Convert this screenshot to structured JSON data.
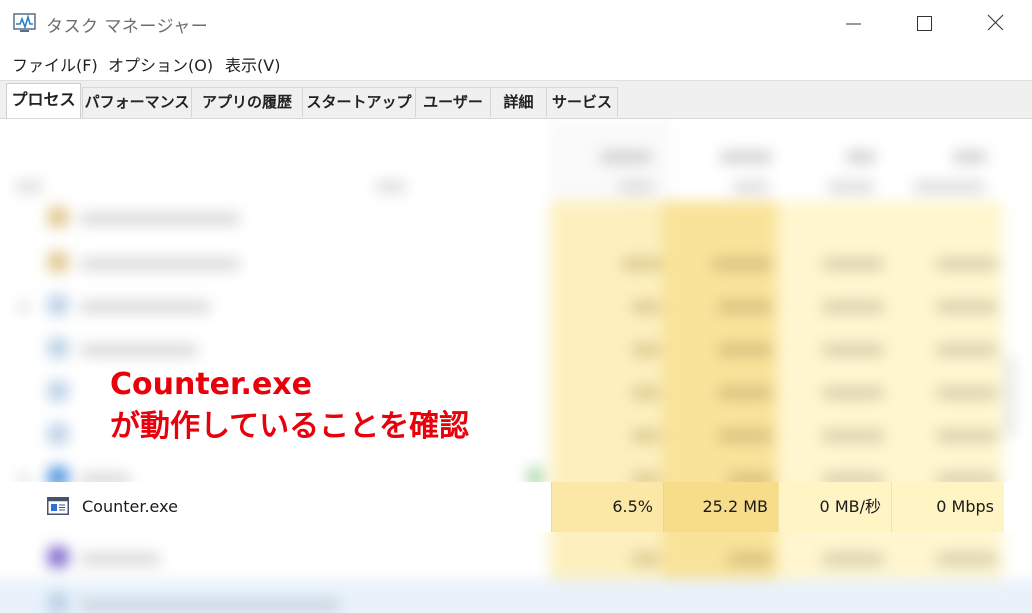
{
  "window": {
    "title": "タスク マネージャー"
  },
  "menu": {
    "file": "ファイル(F)",
    "options": "オプション(O)",
    "view": "表示(V)"
  },
  "tabs": [
    {
      "label": "プロセス",
      "active": true
    },
    {
      "label": "パフォーマンス"
    },
    {
      "label": "アプリの履歴"
    },
    {
      "label": "スタートアップ"
    },
    {
      "label": "ユーザー"
    },
    {
      "label": "詳細"
    },
    {
      "label": "サービス"
    }
  ],
  "process_row": {
    "name": "Counter.exe",
    "cpu": "6.5%",
    "memory": "25.2 MB",
    "disk": "0 MB/秒",
    "network": "0 Mbps"
  },
  "annotation": {
    "line1": "Counter.exe",
    "line2": "が動作していることを確認"
  },
  "colors": {
    "annotation": "#e8000b",
    "cpu_heat": "#fbe8a6",
    "memory_heat": "#f7dd8a",
    "io_heat": "#fff4c4"
  },
  "icons": {
    "app": "task-manager-icon",
    "minimize": "minimize-icon",
    "maximize": "maximize-icon",
    "close": "close-icon",
    "process": "window-app-icon"
  }
}
